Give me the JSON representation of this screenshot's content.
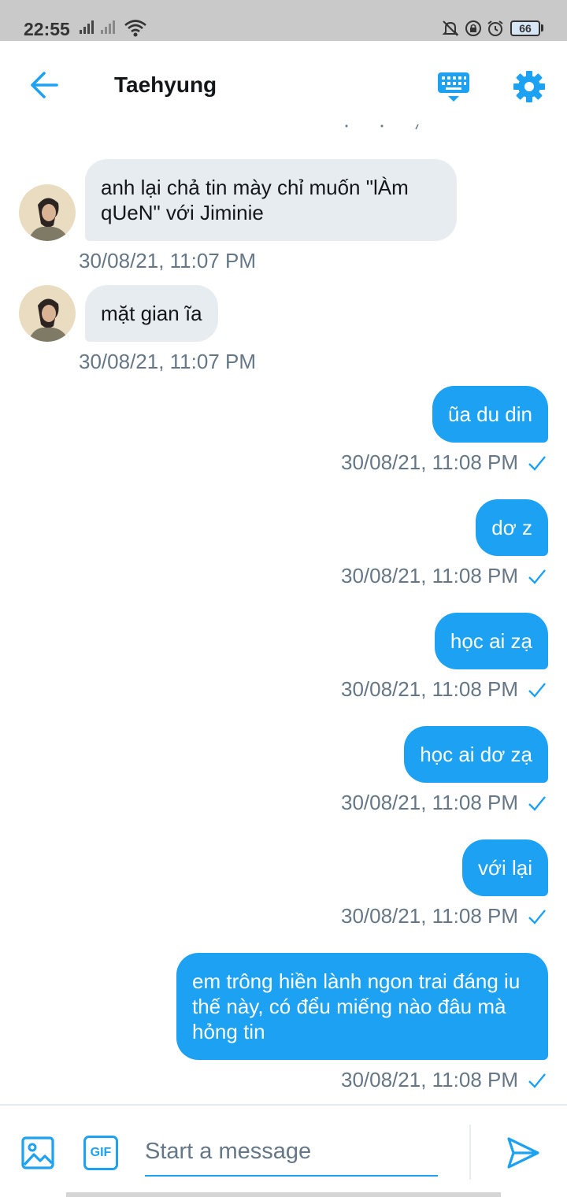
{
  "status_bar": {
    "time": "22:55",
    "battery": "66"
  },
  "header": {
    "title": "Taehyung"
  },
  "messages": [
    {
      "dir": "in",
      "text": "anh lại chả tin mày chỉ muốn \"lÀm qUeN\" với Jiminie",
      "time": "30/08/21, 11:07 PM"
    },
    {
      "dir": "in",
      "text": "mặt gian ĩa",
      "time": "30/08/21, 11:07 PM"
    },
    {
      "dir": "out",
      "text": "ũa du din",
      "time": "30/08/21, 11:08 PM"
    },
    {
      "dir": "out",
      "text": "dơ z",
      "time": "30/08/21, 11:08 PM"
    },
    {
      "dir": "out",
      "text": "học ai zạ",
      "time": "30/08/21, 11:08 PM"
    },
    {
      "dir": "out",
      "text": "học ai dơ zạ",
      "time": "30/08/21, 11:08 PM"
    },
    {
      "dir": "out",
      "text": "với lại",
      "time": "30/08/21, 11:08 PM"
    },
    {
      "dir": "out",
      "text": "em trông hiền lành ngon trai đáng iu thế này, có đểu miếng nào đâu mà hỏng tin",
      "time": "30/08/21, 11:08 PM"
    }
  ],
  "composer": {
    "placeholder": "Start a message",
    "gif_label": "GIF"
  },
  "colors": {
    "accent": "#1da1f2",
    "incoming_bubble": "#e6ecf0",
    "timestamp": "#657786"
  }
}
